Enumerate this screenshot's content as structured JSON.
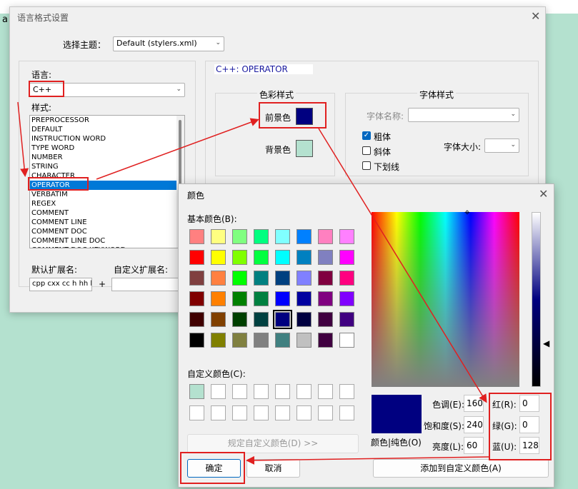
{
  "desktop": {
    "stray_text": "a"
  },
  "style_dialog": {
    "title": "语言格式设置",
    "theme_label": "选择主题：",
    "theme_value": "Default (stylers.xml)",
    "language_label": "语言:",
    "language_value": "C++",
    "style_label": "样式:",
    "styles": [
      "PREPROCESSOR",
      "DEFAULT",
      "INSTRUCTION WORD",
      "TYPE WORD",
      "NUMBER",
      "STRING",
      "CHARACTER",
      "OPERATOR",
      "VERBATIM",
      "REGEX",
      "COMMENT",
      "COMMENT LINE",
      "COMMENT DOC",
      "COMMENT LINE DOC",
      "COMMENT DOC KEYWORD"
    ],
    "selected_style": "OPERATOR",
    "style_description": "C++: OPERATOR",
    "color_group_label": "色彩样式",
    "foreground_label": "前景色",
    "background_label": "背景色",
    "font_group_label": "字体样式",
    "font_name_label": "字体名称:",
    "bold_label": "粗体",
    "italic_label": "斜体",
    "underline_label": "下划线",
    "font_size_label": "字体大小:",
    "default_ext_label": "默认扩展名:",
    "default_ext_value": "cpp cxx cc h hh hpp",
    "plus_label": "+",
    "user_ext_label": "自定义扩展名:",
    "colors": {
      "foreground": "#000080",
      "background": "#b4e1cf"
    }
  },
  "color_dialog": {
    "title": "颜色",
    "basic_colors_label": "基本颜色(B):",
    "basic_colors": [
      [
        "#ff8080",
        "#ffff80",
        "#80ff80",
        "#00ff80",
        "#80ffff",
        "#0080ff",
        "#ff80c0",
        "#ff80ff"
      ],
      [
        "#ff0000",
        "#ffff00",
        "#80ff00",
        "#00ff40",
        "#00ffff",
        "#0080c0",
        "#8080c0",
        "#ff00ff"
      ],
      [
        "#804040",
        "#ff8040",
        "#00ff00",
        "#008080",
        "#004080",
        "#8080ff",
        "#800040",
        "#ff0080"
      ],
      [
        "#800000",
        "#ff8000",
        "#008000",
        "#008040",
        "#0000ff",
        "#0000a0",
        "#800080",
        "#8000ff"
      ],
      [
        "#400000",
        "#804000",
        "#004000",
        "#004040",
        "#000080",
        "#000040",
        "#400040",
        "#400080"
      ],
      [
        "#000000",
        "#808000",
        "#808040",
        "#808080",
        "#408080",
        "#c0c0c0",
        "#400040",
        "#ffffff"
      ]
    ],
    "selected_basic_color": "#000080",
    "custom_colors_label": "自定义颜色(C):",
    "custom_colors": [
      "#b4e1cf",
      "",
      "",
      "",
      "",
      "",
      "",
      "",
      "",
      "",
      "",
      "",
      "",
      "",
      "",
      ""
    ],
    "define_custom_label": "规定自定义颜色(D) >>",
    "color_solid_label": "颜色|纯色(O)",
    "hue_label": "色调(E):",
    "hue_value": "160",
    "sat_label": "饱和度(S):",
    "sat_value": "240",
    "lum_label": "亮度(L):",
    "lum_value": "60",
    "red_label": "红(R):",
    "red_value": "0",
    "green_label": "绿(G):",
    "green_value": "0",
    "blue_label": "蓝(U):",
    "blue_value": "128",
    "ok_label": "确定",
    "cancel_label": "取消",
    "add_custom_label": "添加到自定义颜色(A)",
    "current_color": "#000080"
  },
  "annotation_color": "#e02020"
}
